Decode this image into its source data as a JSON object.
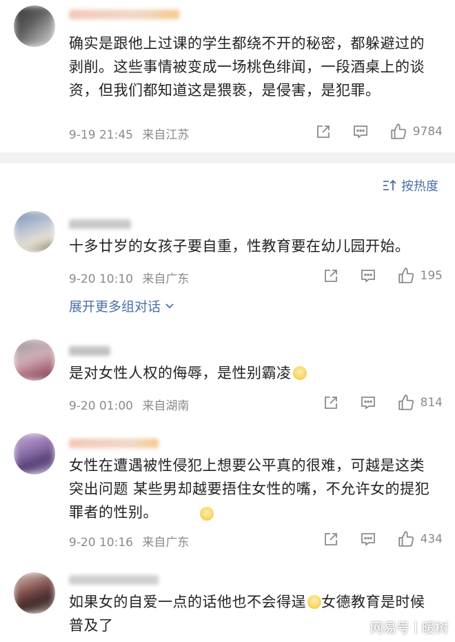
{
  "sort": {
    "label": "按热度"
  },
  "comments": [
    {
      "text": "确实是跟他上过课的学生都绕不开的秘密，都躲避过的剥削。这些事情被变成一场桃色绯闻，一段酒桌上的谈资，但我们都知道这是猥亵，是侵害，是犯罪。",
      "time": "9-19 21:45",
      "location": "来自江苏",
      "likes": "9784"
    },
    {
      "text": "十多廿岁的女孩子要自重，性教育要在幼儿园开始。",
      "time": "9-20 10:10",
      "location": "来自广东",
      "likes": "195",
      "expand": "展开更多组对话"
    },
    {
      "text": "是对女性人权的侮辱，是性别霸凌",
      "time": "9-20 01:00",
      "location": "来自湖南",
      "likes": "814"
    },
    {
      "text": "女性在遭遇被性侵犯上想要公平真的很难，可越是这类突出问题 某些男却越要捂住女性的嘴，不允许女的提犯罪者的性别。",
      "time": "9-20 10:16",
      "location": "来自广东",
      "likes": "434"
    },
    {
      "text": "如果女的自爱一点的话他也不会得逞",
      "text_cont": "女德教育是时候普及了"
    }
  ],
  "watermark": {
    "brand": "网易号",
    "author": "暖树"
  }
}
